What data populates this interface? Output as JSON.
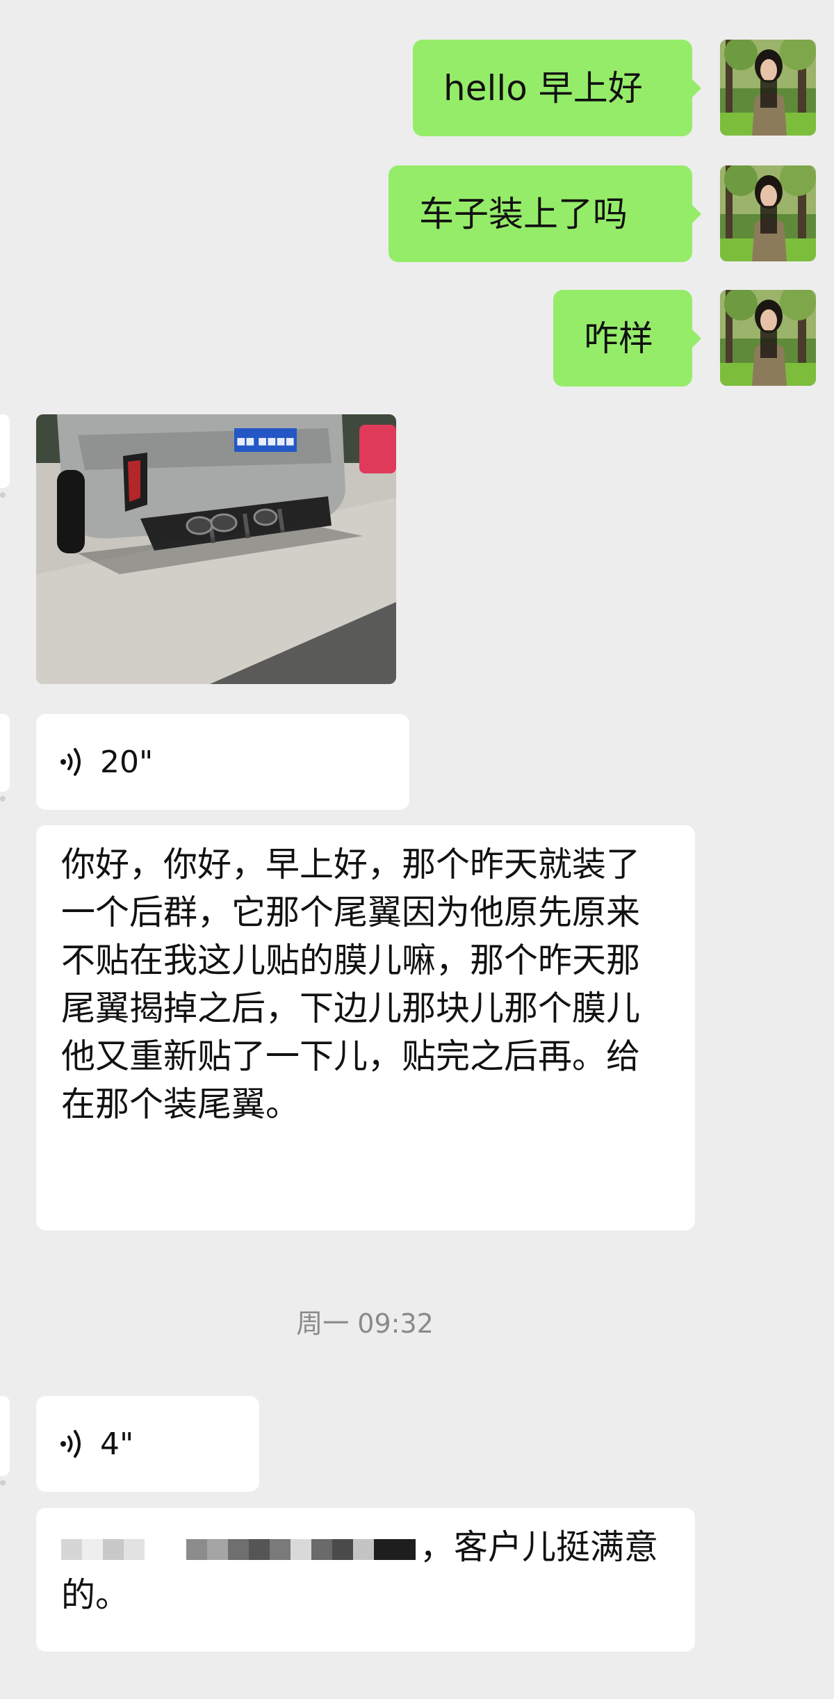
{
  "messages_out": [
    {
      "text": "hello 早上好"
    },
    {
      "text": "车子装上了吗"
    },
    {
      "text": "咋样"
    }
  ],
  "photo_message": {
    "description": "silver car rear bumper with diffuser and quad exhaust, parked on pavement"
  },
  "voice_messages": [
    {
      "duration": "20\""
    },
    {
      "duration": "4\""
    }
  ],
  "transcripts": [
    {
      "text": "你好，你好，早上好，那个昨天就装了一个后群，它那个尾翼因为他原先原来不贴在我这儿贴的膜儿嘛，那个昨天那尾翼揭掉之后，下边儿那块儿那个膜儿他又重新贴了一下儿，贴完之后再。给在那个装尾翼。"
    },
    {
      "suffix": "，客户儿挺满意的。"
    }
  ],
  "timestamp": "周一 09:32",
  "colors": {
    "background": "#ededed",
    "outgoing_bubble": "#95ec69",
    "incoming_bubble": "#ffffff",
    "timestamp_text": "#8a8a8a"
  },
  "icons": {
    "voice": "voice-wave-icon"
  }
}
